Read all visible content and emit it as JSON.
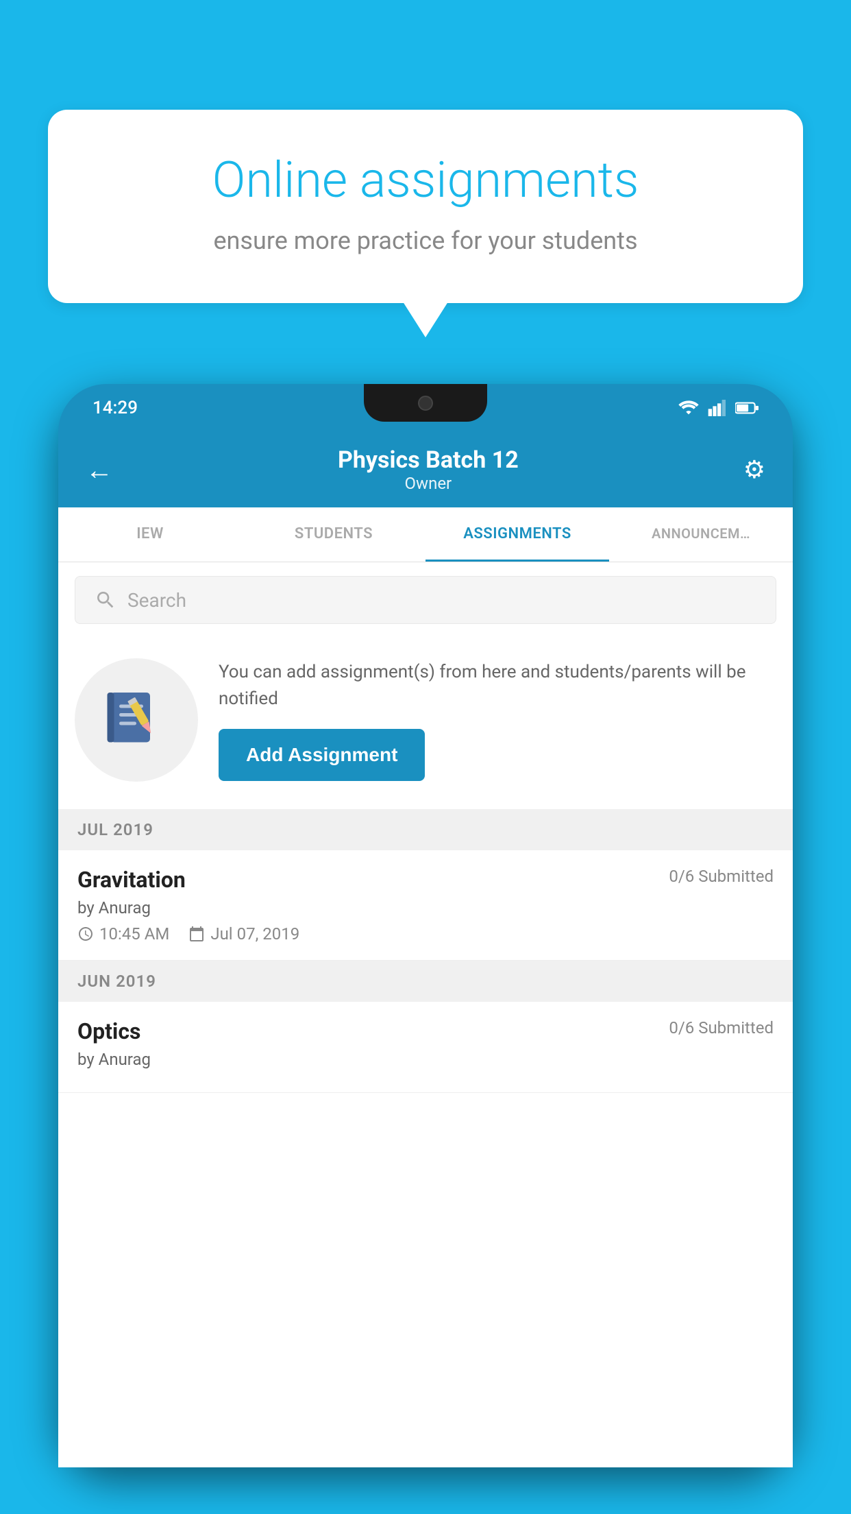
{
  "background_color": "#1ab7ea",
  "bubble": {
    "title": "Online assignments",
    "subtitle": "ensure more practice for your students"
  },
  "status_bar": {
    "time": "14:29",
    "icons": [
      "wifi",
      "signal",
      "battery"
    ]
  },
  "app_bar": {
    "title": "Physics Batch 12",
    "subtitle": "Owner",
    "back_label": "←",
    "settings_label": "⚙"
  },
  "tabs": [
    {
      "label": "IEW",
      "active": false
    },
    {
      "label": "STUDENTS",
      "active": false
    },
    {
      "label": "ASSIGNMENTS",
      "active": true
    },
    {
      "label": "ANNOUNCEM…",
      "active": false
    }
  ],
  "search": {
    "placeholder": "Search"
  },
  "empty_state": {
    "description": "You can add assignment(s) from here and students/parents will be notified",
    "button_label": "Add Assignment"
  },
  "sections": [
    {
      "header": "JUL 2019",
      "assignments": [
        {
          "name": "Gravitation",
          "submitted": "0/6 Submitted",
          "by": "by Anurag",
          "time": "10:45 AM",
          "date": "Jul 07, 2019"
        }
      ]
    },
    {
      "header": "JUN 2019",
      "assignments": [
        {
          "name": "Optics",
          "submitted": "0/6 Submitted",
          "by": "by Anurag",
          "time": "",
          "date": ""
        }
      ]
    }
  ]
}
